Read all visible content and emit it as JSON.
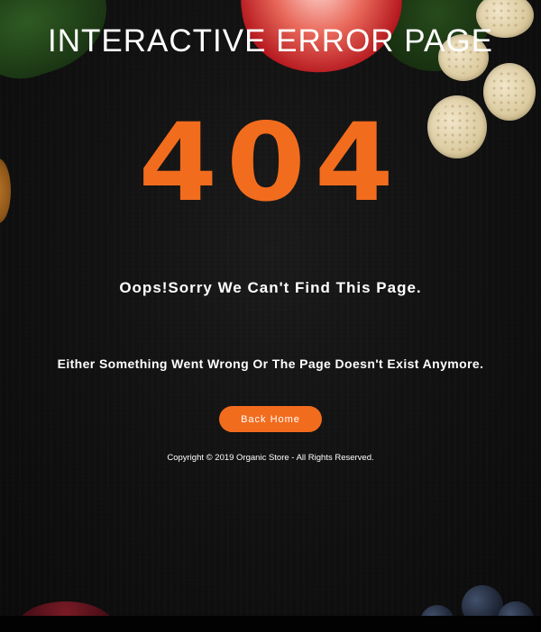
{
  "page": {
    "title": "INTERACTIVE ERROR PAGE",
    "error_code": "404",
    "headline": "Oops!Sorry We Can't Find This Page.",
    "description": "Either Something Went Wrong Or The Page Doesn't Exist Anymore.",
    "back_button_label": "Back Home",
    "copyright": "Copyright © 2019 Organic Store - All Rights Reserved."
  },
  "colors": {
    "accent": "#f26c1e",
    "background": "#121212",
    "text": "#ffffff"
  },
  "decorations": [
    "spinach-leaf",
    "strawberry",
    "rice-crackers",
    "orange-slice",
    "red-bowl",
    "blueberries"
  ]
}
